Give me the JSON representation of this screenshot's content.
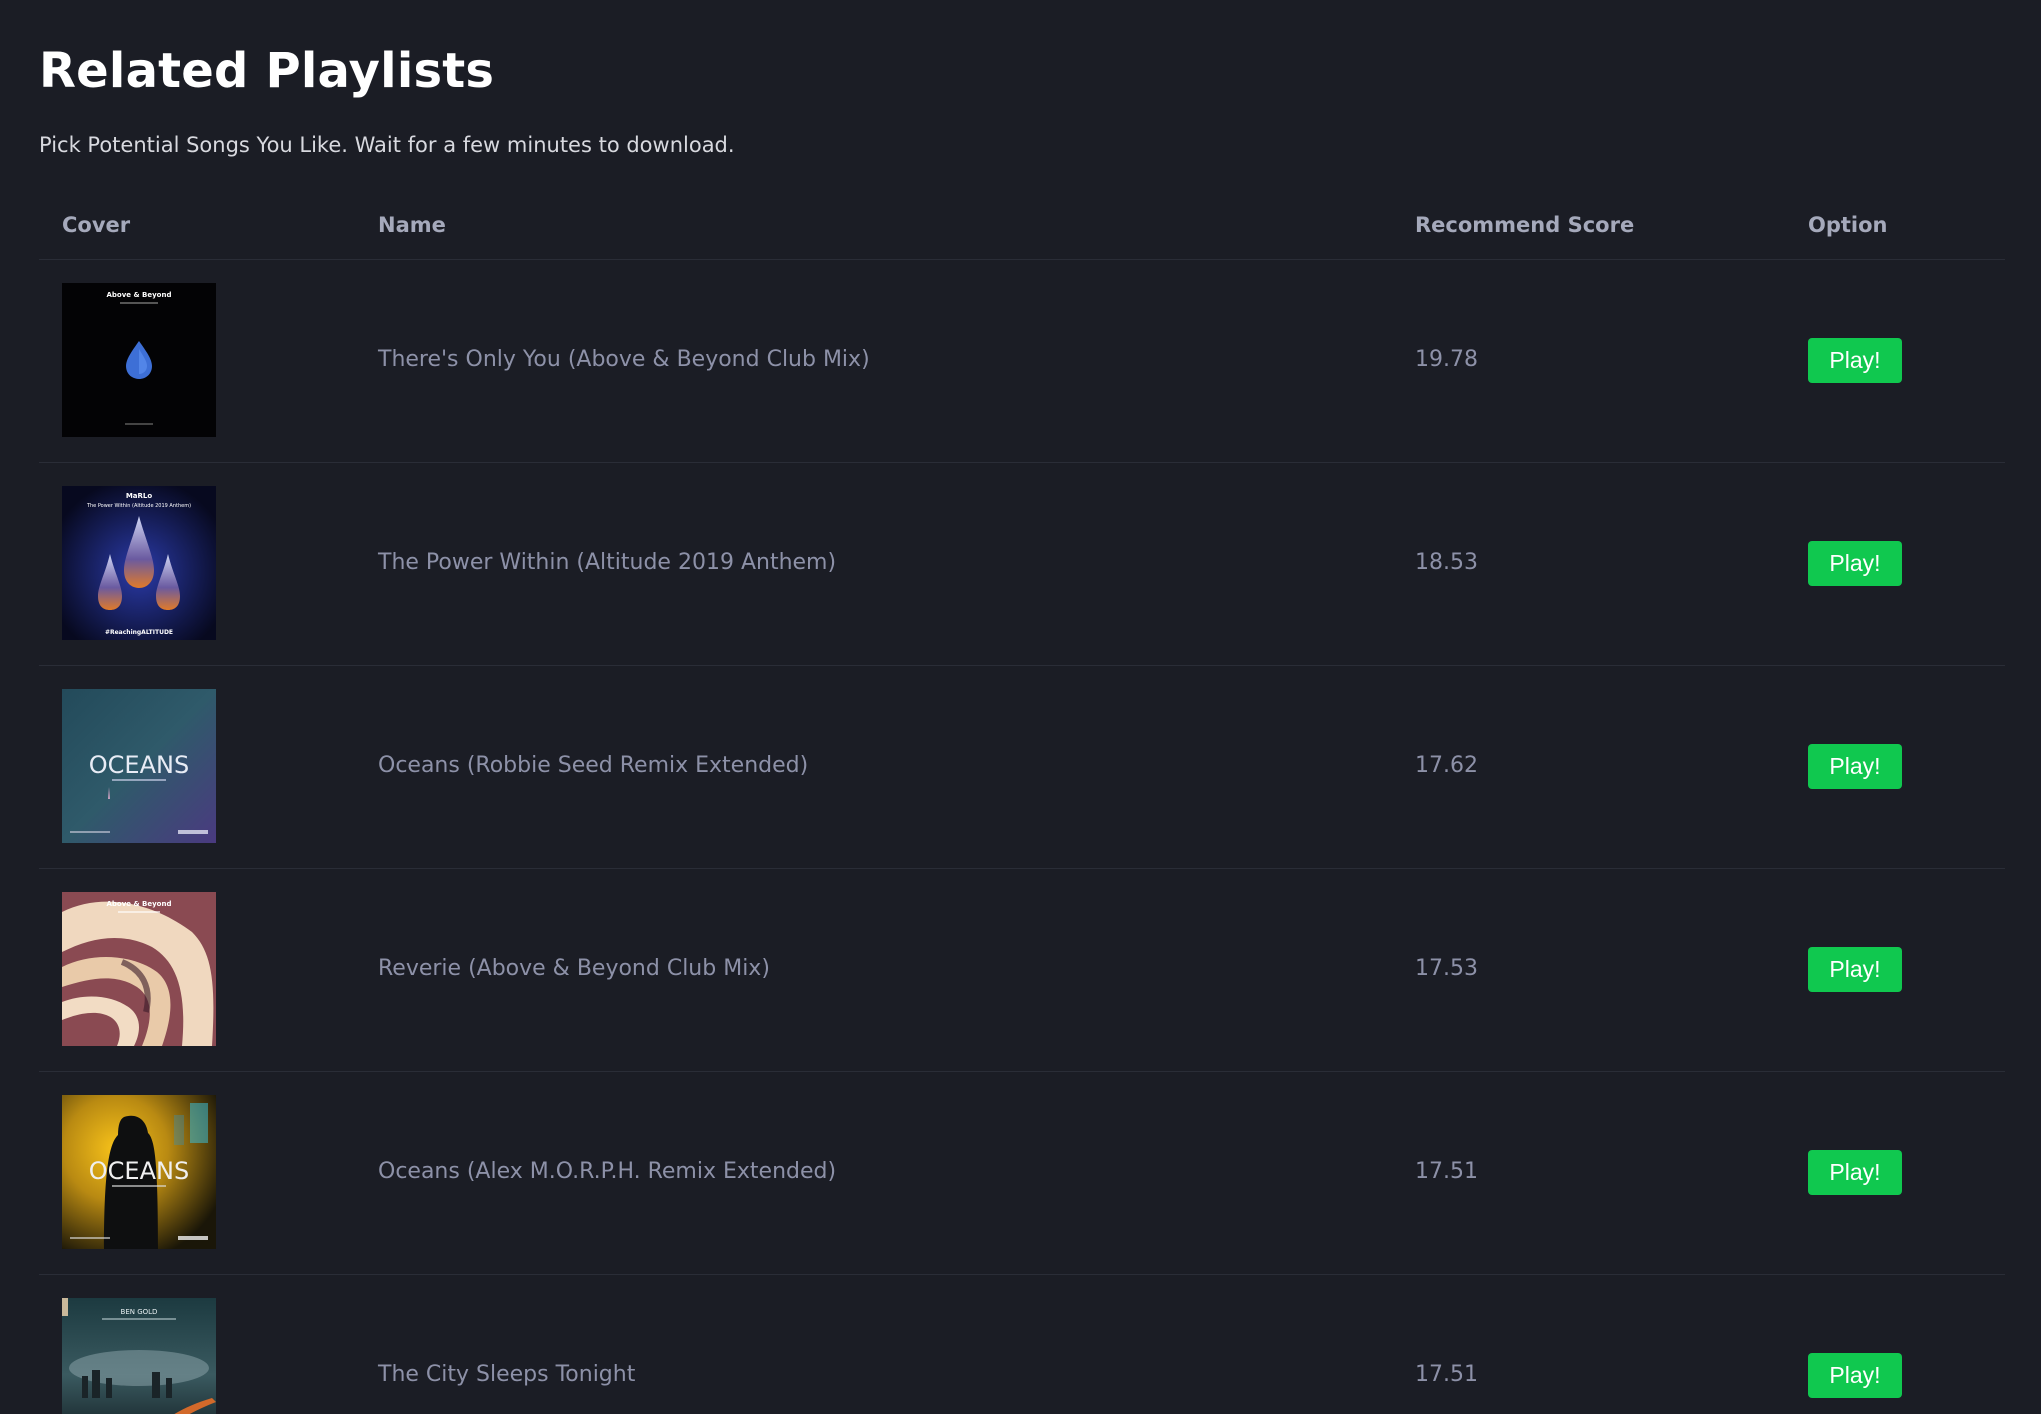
{
  "page": {
    "title": "Related Playlists",
    "subtitle": "Pick Potential Songs You Like. Wait for a few minutes to download."
  },
  "table": {
    "headers": [
      "Cover",
      "Name",
      "Recommend Score",
      "Option"
    ],
    "rows": [
      {
        "name": "There's Only You (Above & Beyond Club Mix)",
        "score": "19.78",
        "option": "Play!",
        "cover_icon": "album-cover-blue-drop",
        "cover_text": [
          "Above & Beyond"
        ]
      },
      {
        "name": "The Power Within (Altitude 2019 Anthem)",
        "score": "18.53",
        "option": "Play!",
        "cover_icon": "album-cover-crystal-drops",
        "cover_text": [
          "MaRLo",
          "The Power Within (Altitude 2019 Anthem)",
          "#ReachingALTITUDE"
        ]
      },
      {
        "name": "Oceans (Robbie Seed Remix Extended)",
        "score": "17.62",
        "option": "Play!",
        "cover_icon": "album-cover-oceans-teal",
        "cover_text": [
          "OCEANS"
        ]
      },
      {
        "name": "Reverie (Above & Beyond Club Mix)",
        "score": "17.53",
        "option": "Play!",
        "cover_icon": "album-cover-swirl",
        "cover_text": [
          "Above & Beyond"
        ]
      },
      {
        "name": "Oceans (Alex M.O.R.P.H. Remix Extended)",
        "score": "17.51",
        "option": "Play!",
        "cover_icon": "album-cover-oceans-gold",
        "cover_text": [
          "OCEANS"
        ]
      },
      {
        "name": "The City Sleeps Tonight",
        "score": "17.51",
        "option": "Play!",
        "cover_icon": "album-cover-city-night",
        "cover_text": [
          "BEN GOLD"
        ]
      }
    ]
  },
  "colors": {
    "background": "#1b1d25",
    "title": "#ffffff",
    "header_text": "#a5a9bb",
    "cell_text": "#8d91a8",
    "divider": "#2a2d37",
    "button": "#10c84f"
  }
}
